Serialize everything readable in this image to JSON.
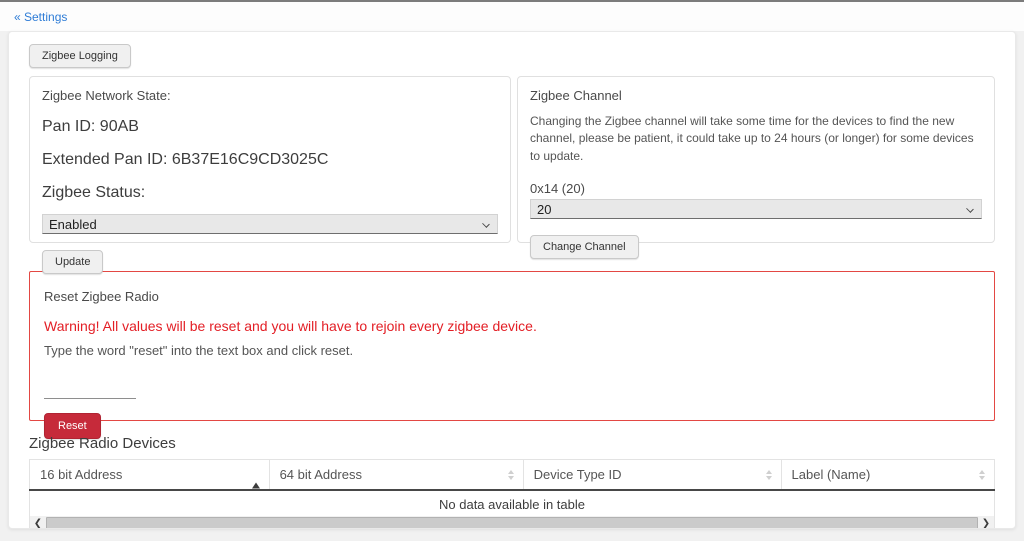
{
  "header": {
    "back_link": "« Settings"
  },
  "toolbar": {
    "logging_button": "Zigbee Logging"
  },
  "network_panel": {
    "title": "Zigbee Network State:",
    "pan_id": "Pan ID: 90AB",
    "extended_pan_id": "Extended Pan ID: 6B37E16C9CD3025C",
    "status_label": "Zigbee Status:",
    "status_value": "Enabled",
    "update_button": "Update"
  },
  "channel_panel": {
    "title": "Zigbee Channel",
    "description": "Changing the Zigbee channel will take some time for the devices to find the new channel, please be patient, it could take up to 24 hours (or longer) for some devices to update.",
    "current_channel_label": "0x14 (20)",
    "channel_value": "20",
    "change_button": "Change Channel"
  },
  "reset_panel": {
    "title": "Reset Zigbee Radio",
    "warning": "Warning! All values will be reset and you will have to rejoin every zigbee device.",
    "instruction": "Type the word \"reset\" into the text box and click reset.",
    "input_value": "",
    "reset_button": "Reset"
  },
  "devices_table": {
    "heading": "Zigbee Radio Devices",
    "columns": [
      {
        "label": "16 bit Address",
        "sort": "asc"
      },
      {
        "label": "64 bit Address",
        "sort": "none"
      },
      {
        "label": "Device Type ID",
        "sort": "none"
      },
      {
        "label": "Label (Name)",
        "sort": "none"
      }
    ],
    "empty_message": "No data available in table"
  },
  "colors": {
    "link_blue": "#2e7cd6",
    "danger_button": "#c62a3a",
    "warning_text": "#e31e25",
    "danger_border": "#e34843"
  }
}
